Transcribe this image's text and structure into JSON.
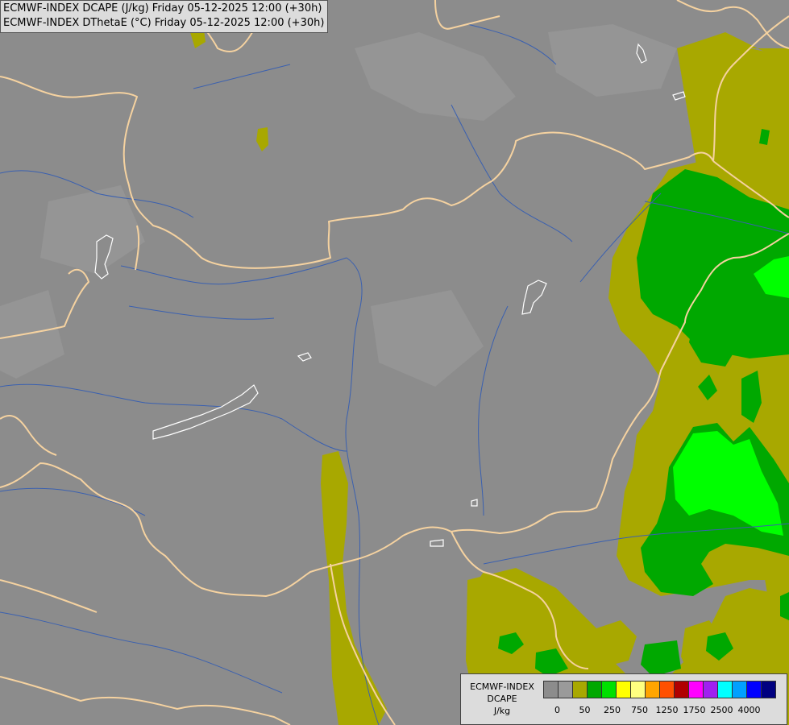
{
  "header": {
    "line1": "ECMWF-INDEX DCAPE (J/kg) Friday 05-12-2025 12:00 (+30h)",
    "line2": "ECMWF-INDEX DThetaE (°C) Friday 05-12-2025 12:00 (+30h)"
  },
  "legend": {
    "line1": "ECMWF-INDEX",
    "line2": "DCAPE",
    "line3": "J/kg",
    "colors": [
      "#8c8c8c",
      "#9a9a9a",
      "#a8a800",
      "#00a800",
      "#00e000",
      "#ffff00",
      "#ffff80",
      "#ffa500",
      "#ff5000",
      "#b00000",
      "#ff00ff",
      "#a020f0",
      "#00ffff",
      "#00a0ff",
      "#0000ff",
      "#000080"
    ],
    "tick_labels": [
      "0",
      "50",
      "250",
      "750",
      "1250",
      "1750",
      "2500",
      "4000"
    ]
  },
  "map_colors": {
    "background": "#8c8c8c",
    "olive": "#a8a800",
    "green": "#00a800",
    "bright_green": "#00ff00",
    "border": "#f5d2a0",
    "river": "#3a60b0",
    "lake": "#ffffff"
  }
}
